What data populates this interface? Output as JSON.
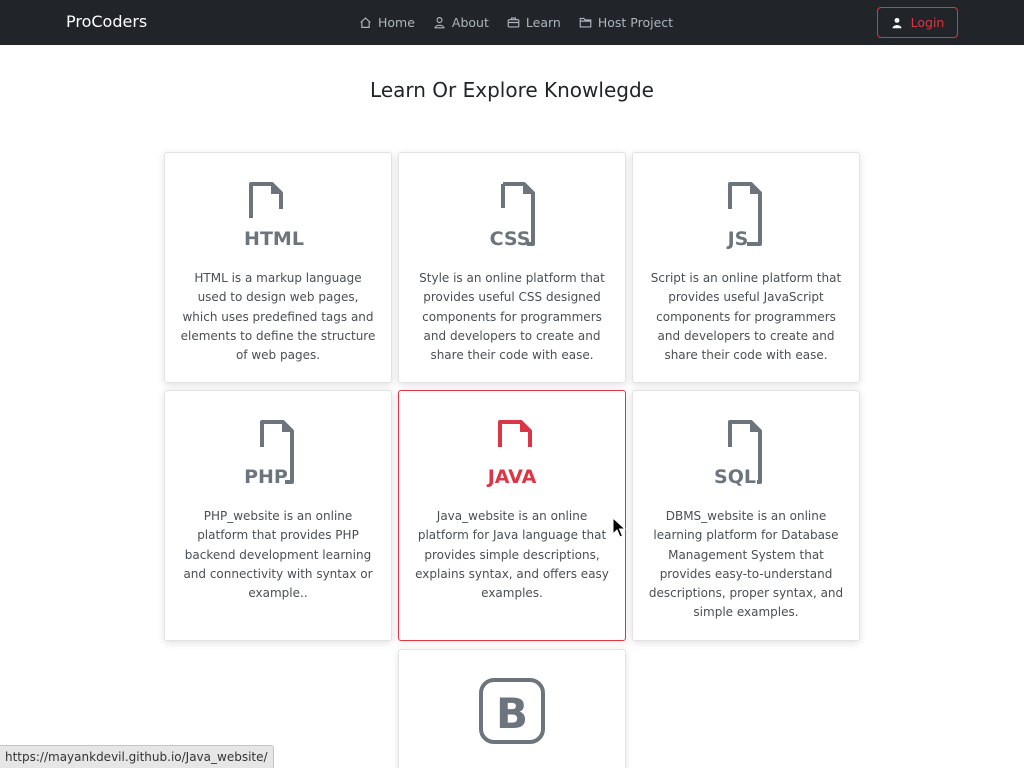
{
  "navbar": {
    "brand": "ProCoders",
    "links": [
      {
        "label": "Home",
        "icon": "home-icon"
      },
      {
        "label": "About",
        "icon": "person-icon"
      },
      {
        "label": "Learn",
        "icon": "briefcase-icon"
      },
      {
        "label": "Host Project",
        "icon": "folder-icon"
      }
    ],
    "login_label": "Login"
  },
  "page": {
    "title": "Learn Or Explore Knowlegde"
  },
  "cards": [
    {
      "icon_text": "HTML",
      "icon": "html-file-icon",
      "description": "HTML is a markup language used to design web pages, which uses predefined tags and elements to define the structure of web pages."
    },
    {
      "icon_text": "CSS",
      "icon": "css-file-icon",
      "description": "Style is an online platform that provides useful CSS designed components for programmers and developers to create and share their code with ease."
    },
    {
      "icon_text": "JS",
      "icon": "js-file-icon",
      "description": "Script is an online platform that provides useful JavaScript components for programmers and developers to create and share their code with ease."
    },
    {
      "icon_text": "PHP",
      "icon": "php-file-icon",
      "description": "PHP_website is an online platform that provides PHP backend development learning and connectivity with syntax or example.."
    },
    {
      "icon_text": "JAVA",
      "icon": "java-file-icon",
      "description": "Java_website is an online platform for Java language that provides simple descriptions, explains syntax, and offers easy examples."
    },
    {
      "icon_text": "SQL",
      "icon": "sql-file-icon",
      "description": "DBMS_website is an online learning platform for Database Management System that provides easy-to-understand descriptions, proper syntax, and simple examples."
    },
    {
      "icon_text": "B",
      "icon": "bootstrap-icon",
      "description": ""
    }
  ],
  "status_bar": {
    "url": "https://mayankdevil.github.io/Java_website/"
  },
  "colors": {
    "navbar_bg": "#212529",
    "accent_red": "#dc3545",
    "icon_gray": "#6c757d"
  }
}
